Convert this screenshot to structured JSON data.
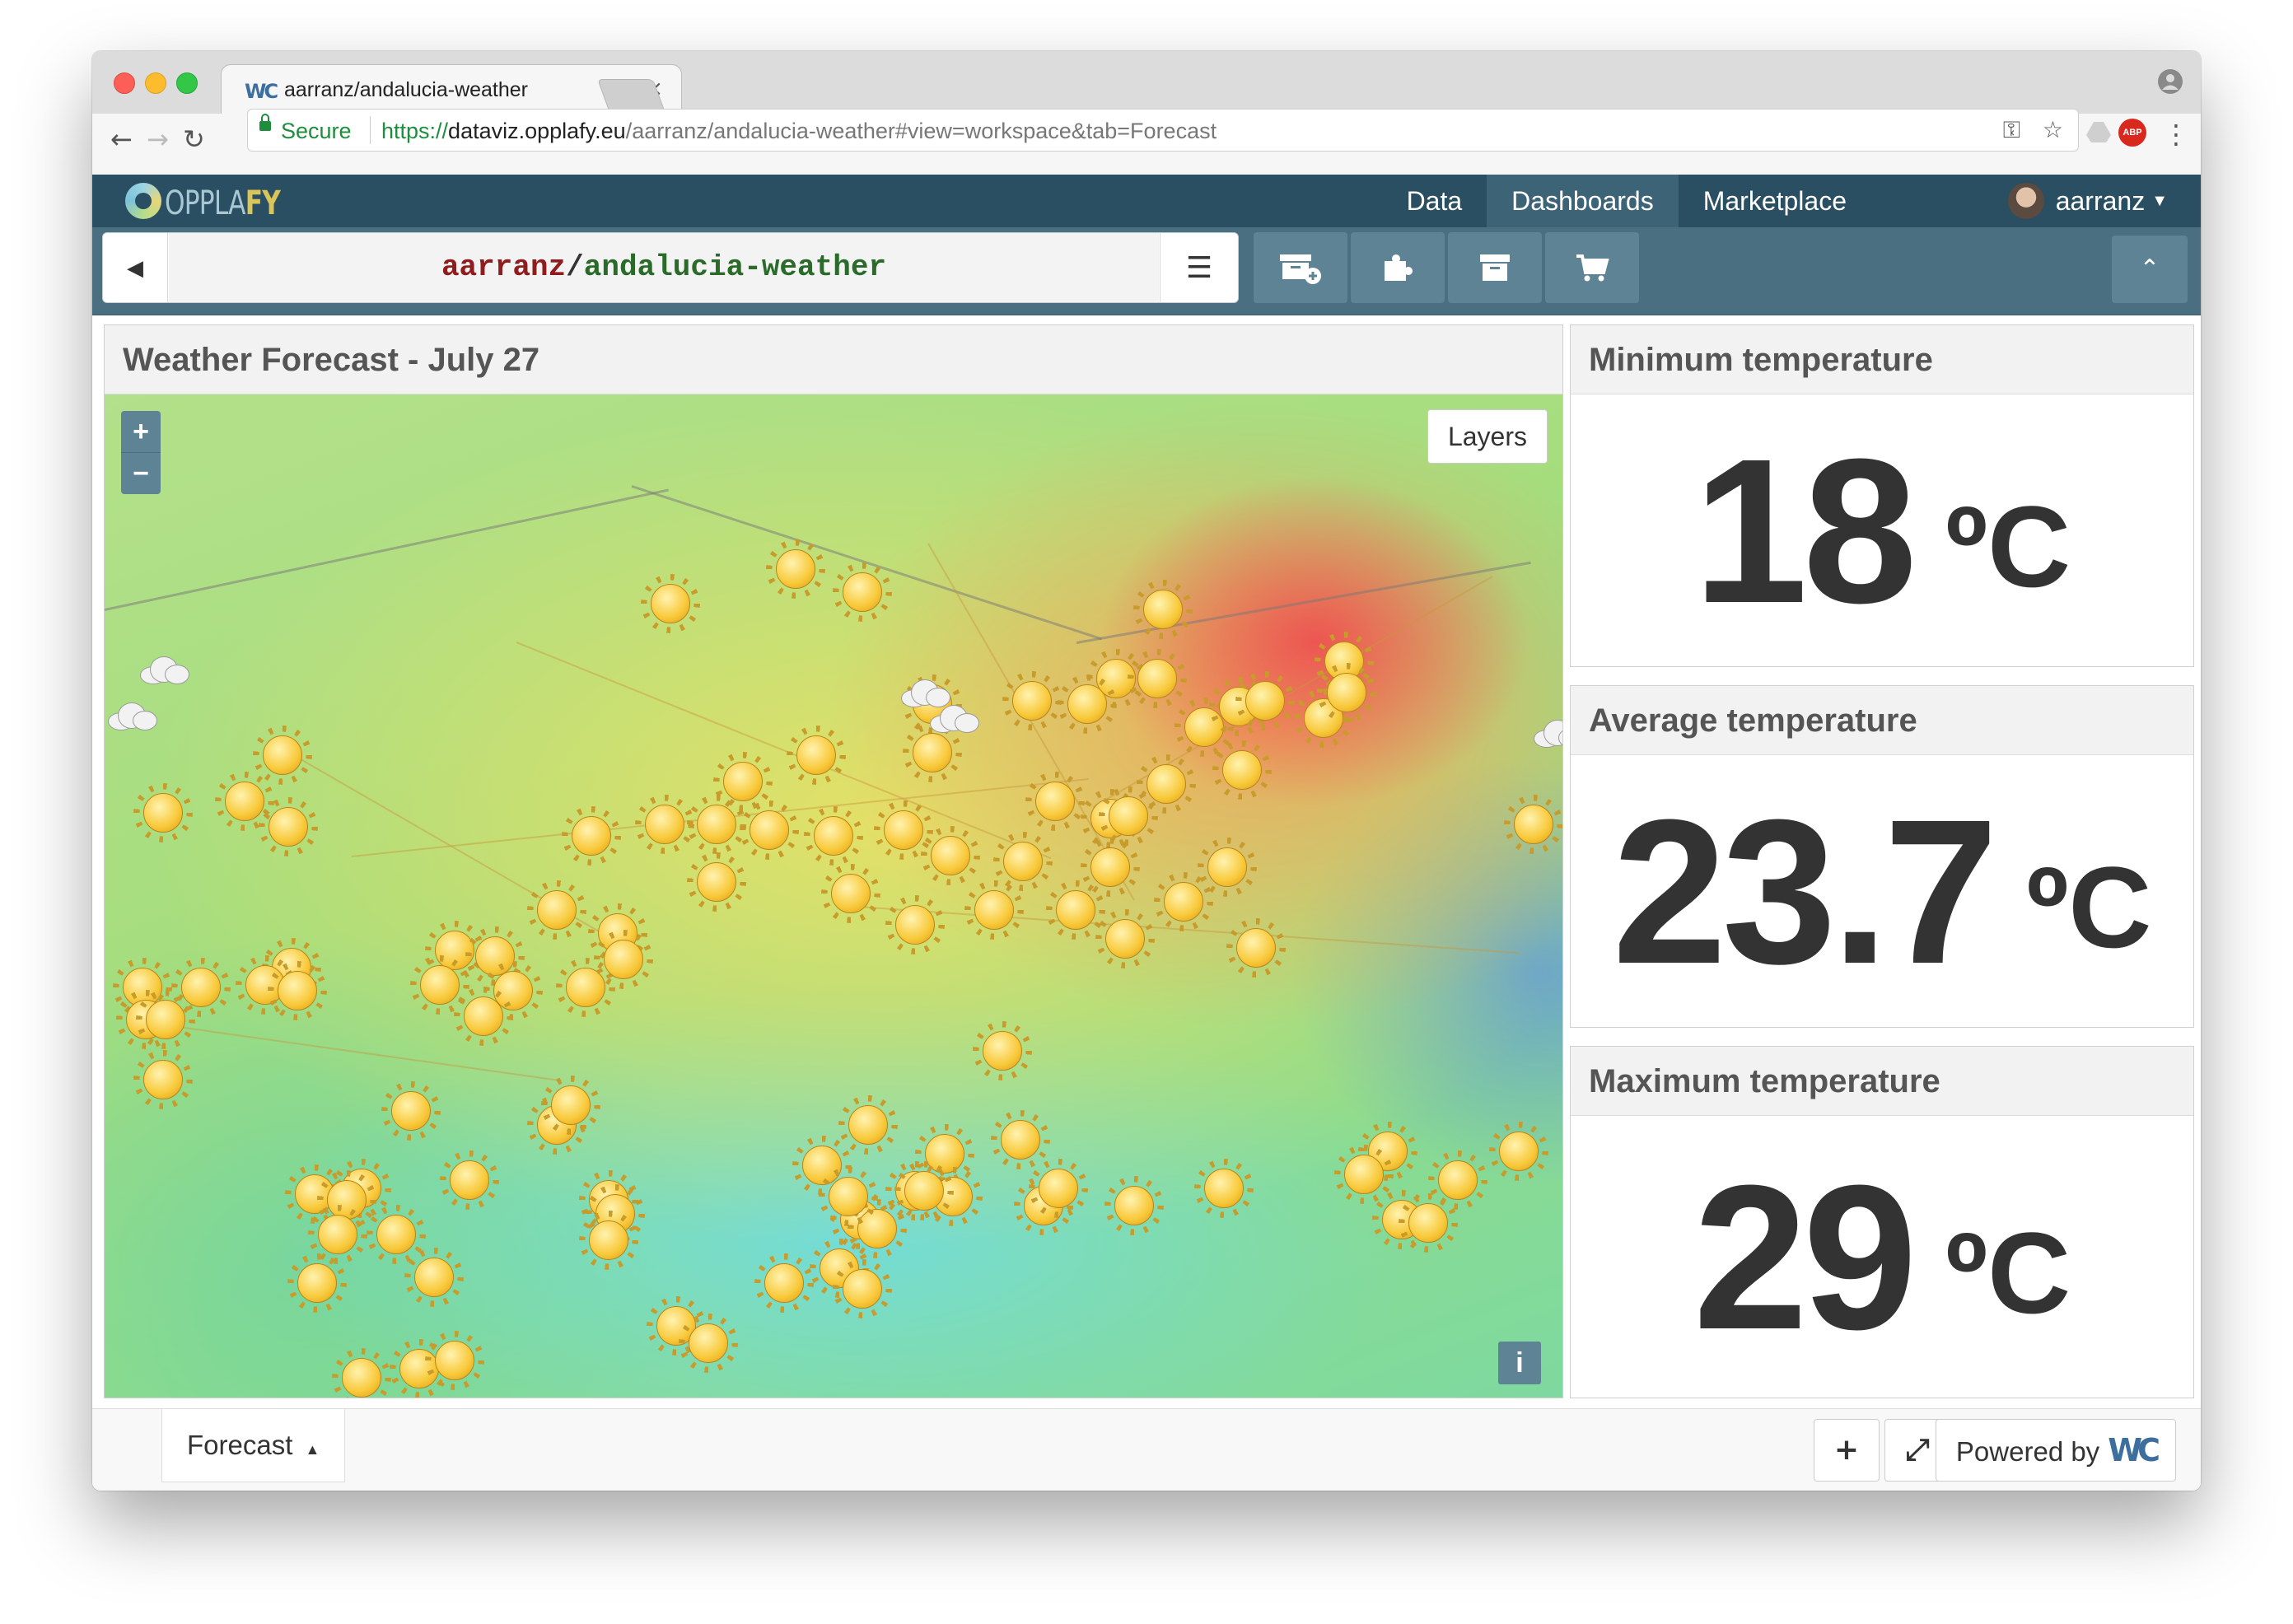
{
  "browser": {
    "tab_title": "aarranz/andalucia-weather",
    "tab_close": "×",
    "favicon": "WC",
    "security_label": "Secure",
    "url_protocol": "https://",
    "url_host": "dataviz.opplafy.eu",
    "url_path": "/aarranz/andalucia-weather#view=workspace&tab=Forecast",
    "extension_abp": "ABP"
  },
  "app": {
    "logo_text_a": "OPPLA",
    "logo_text_b": "FY",
    "nav": [
      {
        "label": "Data",
        "active": false
      },
      {
        "label": "Dashboards",
        "active": true
      },
      {
        "label": "Marketplace",
        "active": false
      }
    ],
    "user": "aarranz"
  },
  "workspace": {
    "owner": "aarranz",
    "separator": "/",
    "name": "andalucia-weather",
    "tools": [
      "new-workspace-icon",
      "add-widget-icon",
      "archive-icon",
      "marketplace-cart-icon"
    ]
  },
  "map_panel": {
    "title": "Weather Forecast - July 27",
    "zoom_in": "+",
    "zoom_out": "−",
    "layers_label": "Layers",
    "info_label": "i",
    "accent_color": "#5e8394"
  },
  "stats": [
    {
      "title": "Minimum temperature",
      "value": "18",
      "unit": "ºC"
    },
    {
      "title": "Average temperature",
      "value": "23.7",
      "unit": "ºC"
    },
    {
      "title": "Maximum temperature",
      "value": "29",
      "unit": "ºC"
    }
  ],
  "bottom": {
    "tab_label": "Forecast",
    "tab_caret": "▲",
    "add_label": "+",
    "fullscreen_label": "⤢",
    "powered_by": "Powered by",
    "powered_logo": "WC"
  },
  "colors": {
    "header_bg": "#2a4e62",
    "workspace_bar_bg": "#4a6f80",
    "owner_color": "#8f1d1d",
    "name_color": "#2a6b2a"
  }
}
